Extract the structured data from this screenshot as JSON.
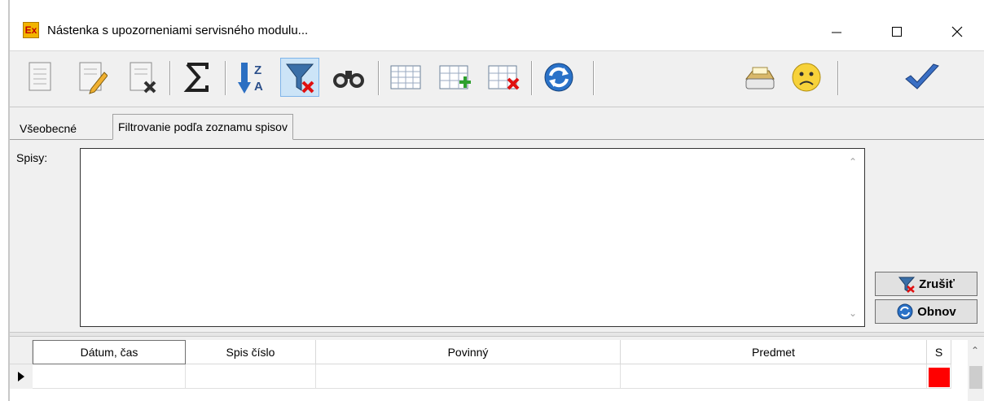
{
  "window": {
    "title": "Nástenka s upozorneniami servisného modulu...",
    "app_icon_text": "Ex"
  },
  "toolbar": {
    "buttons": [
      {
        "icon": "document-copy-icon"
      },
      {
        "icon": "document-edit-icon"
      },
      {
        "icon": "document-delete-icon"
      },
      {
        "icon": "sum-icon"
      },
      {
        "icon": "sort-za-icon"
      },
      {
        "icon": "filter-remove-icon",
        "active": true
      },
      {
        "icon": "binoculars-icon"
      },
      {
        "icon": "table-icon"
      },
      {
        "icon": "table-add-row-icon"
      },
      {
        "icon": "table-delete-row-icon"
      },
      {
        "icon": "refresh-icon"
      },
      {
        "icon": "tray-icon"
      },
      {
        "icon": "sad-face-icon"
      },
      {
        "icon": "checkmark-icon"
      }
    ]
  },
  "tabs": [
    {
      "label": "Všeobecné"
    },
    {
      "label": "Filtrovanie podľa zoznamu spisov",
      "active": true
    }
  ],
  "filter": {
    "spisy_label": "Spisy:",
    "spisy_value": "",
    "cancel_label": "Zrušiť",
    "refresh_label": "Obnov"
  },
  "grid": {
    "columns": [
      "Dátum, čas",
      "Spis číslo",
      "Povinný",
      "Predmet",
      "S"
    ],
    "rows": [
      {
        "datum": "",
        "spis": "",
        "povinny": "",
        "predmet": "",
        "status_color": "#ff0000"
      }
    ]
  },
  "colors": {
    "accent_active": "#cce4f7",
    "status_red": "#ff0000"
  }
}
